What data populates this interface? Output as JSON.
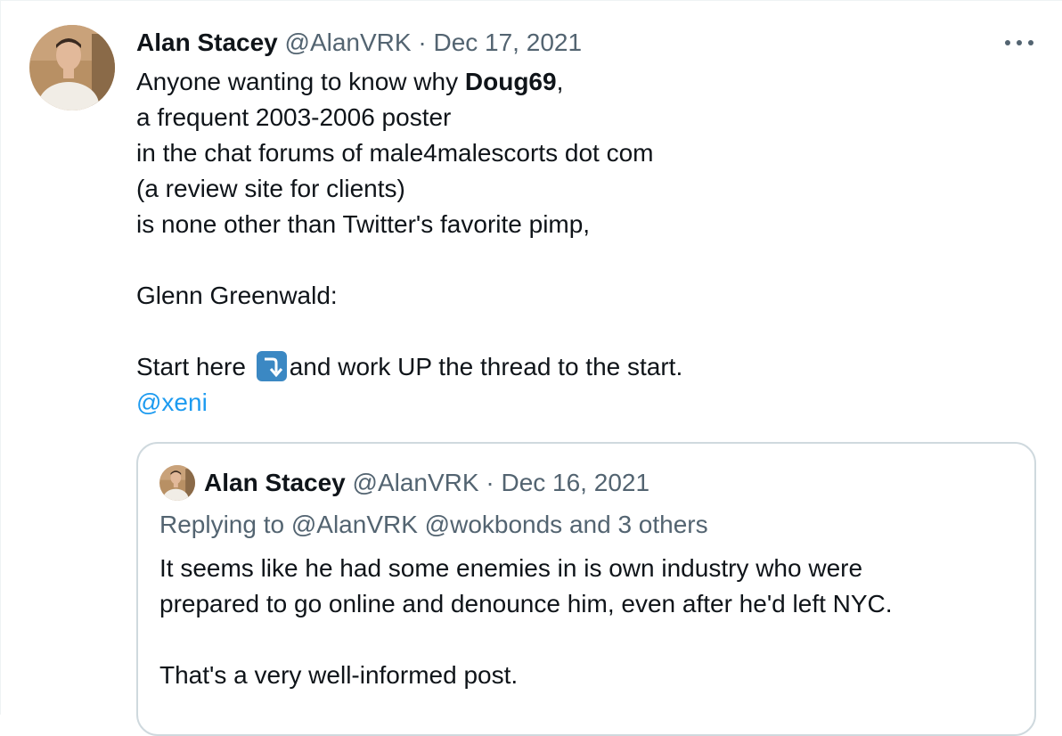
{
  "tweet": {
    "author_name": "Alan Stacey",
    "author_handle": "@AlanVRK",
    "separator": "·",
    "date": "Dec 17, 2021",
    "lines": {
      "l1_pre": "Anyone wanting to know why ",
      "l1_bold": "Doug69",
      "l1_post": ",",
      "l2": "a frequent 2003-2006 poster",
      "l3": "in the chat forums of male4malescorts dot com",
      "l4": "(a review site for clients)",
      "l5": "is none other than Twitter's favorite pimp,",
      "l7": "Glenn Greenwald:",
      "l9_pre": "Start here ",
      "l9_post": "and work UP the thread to the start.",
      "mention": "@xeni"
    },
    "emoji": "right-arrow-curving-down-icon"
  },
  "quoted": {
    "author_name": "Alan Stacey",
    "author_handle": "@AlanVRK",
    "separator": "·",
    "date": "Dec 16, 2021",
    "replying_to": "Replying to @AlanVRK @wokbonds and 3 others",
    "line1": "It seems like he had some enemies in is own industry who were",
    "line2": "prepared to go online and denounce him, even  after he'd left NYC.",
    "line4": "That's a very well-informed post."
  },
  "colors": {
    "text": "#0f1419",
    "muted": "#536471",
    "link": "#1d9bf0",
    "border": "#cfd9de",
    "emoji_bg": "#3b88c3"
  }
}
